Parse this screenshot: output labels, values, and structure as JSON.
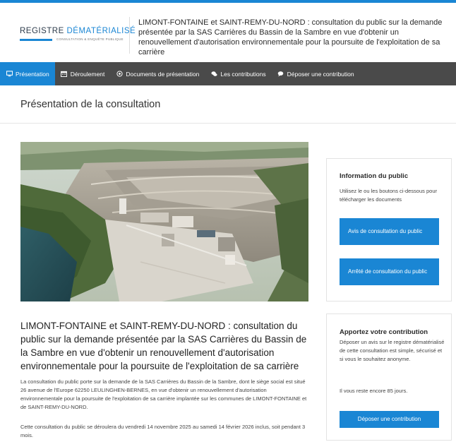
{
  "header": {
    "logo_word1": "REGISTRE",
    "logo_word2": "DÉMATÉRIALISÉ",
    "logo_tagline": "CONSULTATION & ENQUÊTE PUBLIQUE",
    "title": "LIMONT-FONTAINE et SAINT-REMY-DU-NORD : consultation du public sur la demande présentée par la SAS Carrières du Bassin de la Sambre en vue d'obtenir un renouvellement d'autorisation environnementale pour la poursuite de l'exploitation de sa carrière"
  },
  "nav": {
    "items": [
      {
        "label": "Présentation",
        "icon": "monitor-icon"
      },
      {
        "label": "Déroulement",
        "icon": "calendar-icon"
      },
      {
        "label": "Documents de présentation",
        "icon": "documents-icon"
      },
      {
        "label": "Les contributions",
        "icon": "comments-icon"
      },
      {
        "label": "Déposer une contribution",
        "icon": "speech-bubble-icon"
      }
    ]
  },
  "main": {
    "section_title": "Présentation de la consultation",
    "photo_alt": "quarry-aerial-photo",
    "title": "LIMONT-FONTAINE et SAINT-REMY-DU-NORD : consultation du public sur la demande présentée par la SAS Carrières du Bassin de la Sambre en vue d'obtenir un renouvellement d'autorisation environnementale pour la poursuite de l'exploitation de sa carrière",
    "paragraph1": "La consultation du public porte sur la demande de la SAS Carrières du Bassin de la Sambre, dont le siège social est situé 26 avenue de l'Europe 62250 LEULINGHEN-BERNES, en vue d'obtenir un renouvellement d'autorisation environnementale pour la poursuite de l'exploitation de sa carrière implantée sur les communes de LIMONT-FONTAINE et de SAINT-REMY-DU-NORD.",
    "paragraph2": "Cette consultation du public se déroulera du vendredi 14 novembre 2025 au samedi 14 février 2026 inclus, soit pendant 3 mois."
  },
  "info_card": {
    "title": "Information du public",
    "text": "Utilisez le ou les boutons ci-dessous pour télécharger les documents",
    "btn1": "Avis de consultation du public",
    "btn2": "Arrêté de consultation du public"
  },
  "contrib_card": {
    "title": "Apportez votre contribution",
    "text": "Déposer un avis sur le registre dématérialisé de cette consultation est simple, sécurisé et si vous le souhaitez anonyme.",
    "remaining": "Il vous reste encore 85 jours.",
    "button": "Déposer une contribution"
  },
  "colors": {
    "accent": "#1a86d4",
    "nav_bg": "#4a4a4a"
  }
}
